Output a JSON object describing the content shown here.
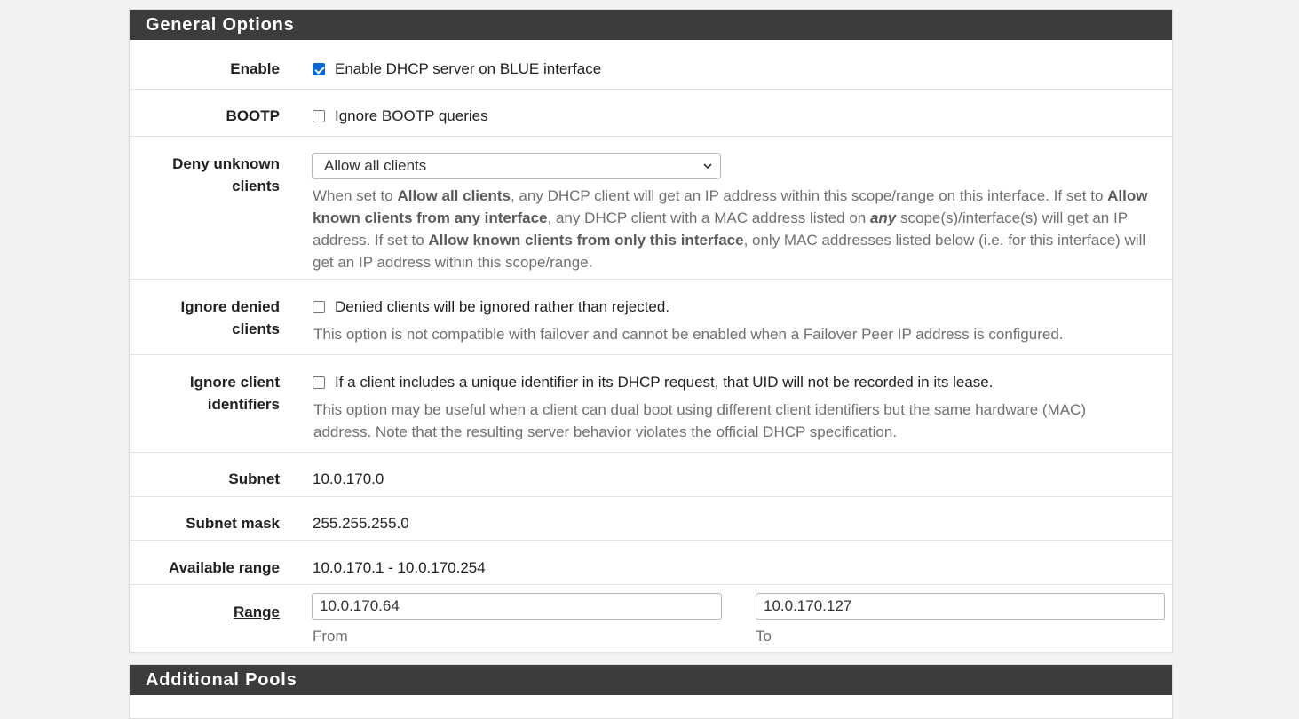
{
  "general_options": {
    "title": "General Options",
    "enable": {
      "label": "Enable",
      "checkbox_text": "Enable DHCP server on BLUE interface",
      "checked": true
    },
    "bootp": {
      "label": "BOOTP",
      "checkbox_text": "Ignore BOOTP queries",
      "checked": false
    },
    "deny_unknown": {
      "label_line1": "Deny unknown",
      "label_line2": "clients",
      "selected": "Allow all clients",
      "help": [
        {
          "t": "When set to ",
          "b": false
        },
        {
          "t": "Allow all clients",
          "b": true
        },
        {
          "t": ", any DHCP client will get an IP address within this scope/range on this interface. If set to ",
          "b": false
        },
        {
          "t": "Allow known clients from any interface",
          "b": true
        },
        {
          "t": ", any DHCP client with a MAC address listed on ",
          "b": false
        },
        {
          "t": "any",
          "b": true,
          "i": true
        },
        {
          "t": " scope(s)/interface(s) will get an IP address. If set to ",
          "b": false
        },
        {
          "t": "Allow known clients from only this interface",
          "b": true
        },
        {
          "t": ", only MAC addresses listed below (i.e. for this interface) will get an IP address within this scope/range.",
          "b": false
        }
      ]
    },
    "ignore_denied": {
      "label_line1": "Ignore denied",
      "label_line2": "clients",
      "checkbox_text": "Denied clients will be ignored rather than rejected.",
      "checked": false,
      "help": "This option is not compatible with failover and cannot be enabled when a Failover Peer IP address is configured."
    },
    "ignore_client_ids": {
      "label_line1": "Ignore client",
      "label_line2": "identifiers",
      "checkbox_text": "If a client includes a unique identifier in its DHCP request, that UID will not be recorded in its lease.",
      "checked": false,
      "help": "This option may be useful when a client can dual boot using different client identifiers but the same hardware (MAC) address. Note that the resulting server behavior violates the official DHCP specification."
    },
    "subnet": {
      "label": "Subnet",
      "value": "10.0.170.0"
    },
    "subnet_mask": {
      "label": "Subnet mask",
      "value": "255.255.255.0"
    },
    "available_range": {
      "label": "Available range",
      "value": "10.0.170.1 - 10.0.170.254"
    },
    "range": {
      "label": "Range",
      "from_value": "10.0.170.64",
      "to_value": "10.0.170.127",
      "from_label": "From",
      "to_label": "To"
    }
  },
  "additional_pools": {
    "title": "Additional Pools"
  },
  "colors": {
    "heading_bg": "#3c3c3c",
    "checkbox_checked": "#0a67d8",
    "page_bg": "#f2f2f2"
  },
  "icons": {
    "select_chevron": "chevron-down-icon",
    "checkbox_checked": "check-icon"
  }
}
